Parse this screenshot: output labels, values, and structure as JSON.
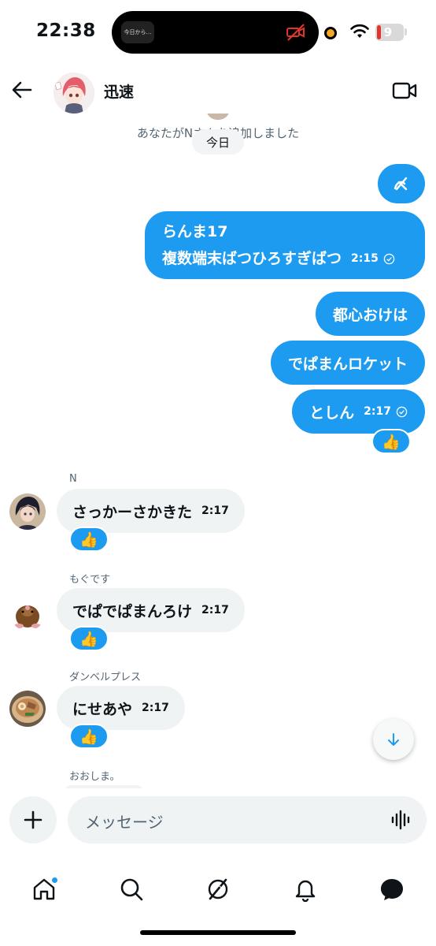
{
  "status": {
    "time": "22:38",
    "island_thumb_text": "今日から…",
    "battery": "9"
  },
  "header": {
    "contact_name": "迅速"
  },
  "chat": {
    "system_message": "あなたがNさんを追加しました",
    "date_chip": "今日",
    "outgoing": [
      {
        "lines": [
          "らんま17",
          "複数端末ばつひろすぎばつ"
        ],
        "time": "2:15"
      },
      {
        "text": "都心おけは"
      },
      {
        "text": "でぱまんロケット"
      },
      {
        "text": "としん",
        "time": "2:17",
        "reaction": "👍"
      }
    ],
    "incoming": [
      {
        "sender": "N",
        "text": "さっかーさかきた",
        "time": "2:17",
        "reaction": "👍"
      },
      {
        "sender": "もぐです",
        "text": "でぱでぱまんろけ",
        "time": "2:17",
        "reaction": "👍"
      },
      {
        "sender": "ダンベルプレス",
        "text": "にせあや",
        "time": "2:17",
        "reaction": "👍"
      },
      {
        "sender": "おおしま。"
      }
    ]
  },
  "composer": {
    "placeholder": "メッセージ"
  },
  "tabs": [
    "home",
    "search",
    "grok",
    "notifications",
    "messages"
  ],
  "colors": {
    "accent": "#1d9bf0",
    "incoming_bubble": "#eff3f4",
    "muted_text": "#536471"
  }
}
